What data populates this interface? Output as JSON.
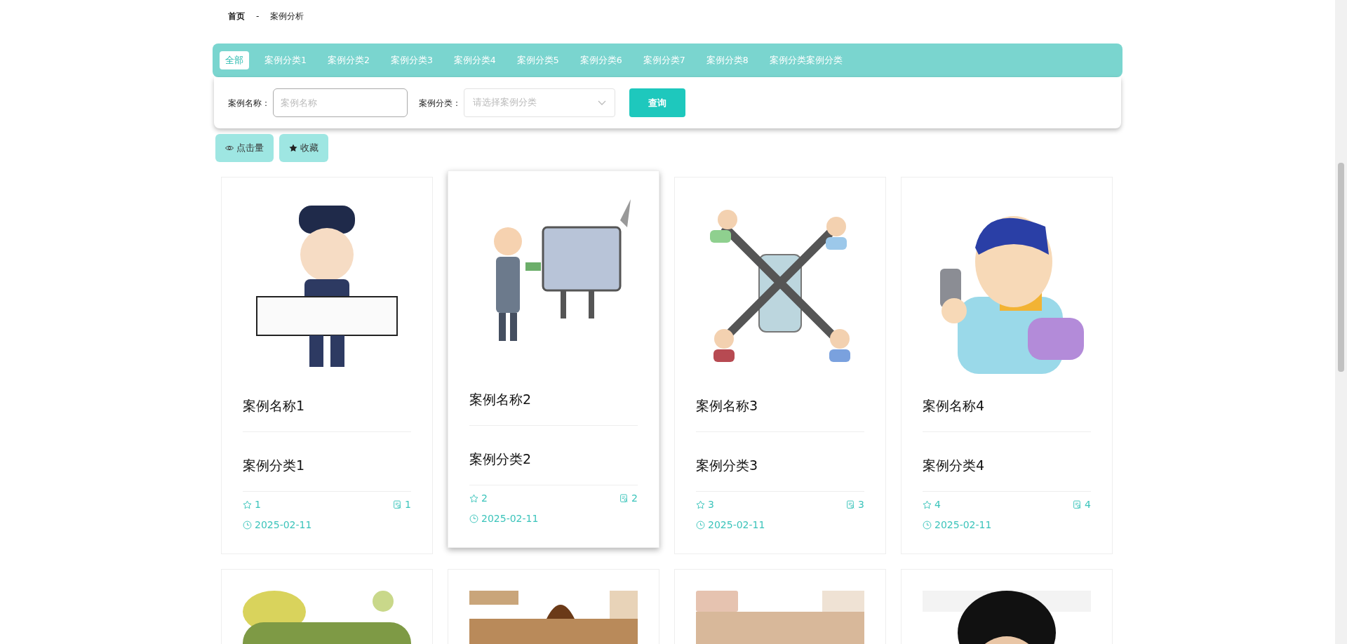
{
  "breadcrumb": {
    "home": "首页",
    "separator": "-",
    "current": "案例分析"
  },
  "tabs": [
    {
      "label": "全部",
      "selected": true
    },
    {
      "label": "案例分类1",
      "selected": false
    },
    {
      "label": "案例分类2",
      "selected": false
    },
    {
      "label": "案例分类3",
      "selected": false
    },
    {
      "label": "案例分类4",
      "selected": false
    },
    {
      "label": "案例分类5",
      "selected": false
    },
    {
      "label": "案例分类6",
      "selected": false
    },
    {
      "label": "案例分类7",
      "selected": false
    },
    {
      "label": "案例分类8",
      "selected": false
    },
    {
      "label": "案例分类案例分类",
      "selected": false
    }
  ],
  "search": {
    "fields": [
      {
        "kind": "text",
        "label": "案例名称：",
        "placeholder": "案例名称"
      },
      {
        "kind": "select",
        "label": "案例分类：",
        "placeholder": "请选择案例分类"
      }
    ],
    "button": "查询"
  },
  "sort_buttons": [
    {
      "kind": "eye",
      "label": "点击量"
    },
    {
      "kind": "star",
      "label": "收藏"
    }
  ],
  "cards": [
    {
      "kind": "full",
      "name": "案例名称1",
      "category": "案例分类1",
      "favorites": "1",
      "views": "1",
      "date": "2025-02-11",
      "raised": false
    },
    {
      "kind": "full",
      "name": "案例名称2",
      "category": "案例分类2",
      "favorites": "2",
      "views": "2",
      "date": "2025-02-11",
      "raised": true
    },
    {
      "kind": "full",
      "name": "案例名称3",
      "category": "案例分类3",
      "favorites": "3",
      "views": "3",
      "date": "2025-02-11",
      "raised": false
    },
    {
      "kind": "full",
      "name": "案例名称4",
      "category": "案例分类4",
      "favorites": "4",
      "views": "4",
      "date": "2025-02-11",
      "raised": false
    },
    {
      "kind": "partial",
      "raised": false
    },
    {
      "kind": "partial",
      "raised": false
    },
    {
      "kind": "partial",
      "raised": false
    },
    {
      "kind": "partial",
      "raised": false
    }
  ]
}
